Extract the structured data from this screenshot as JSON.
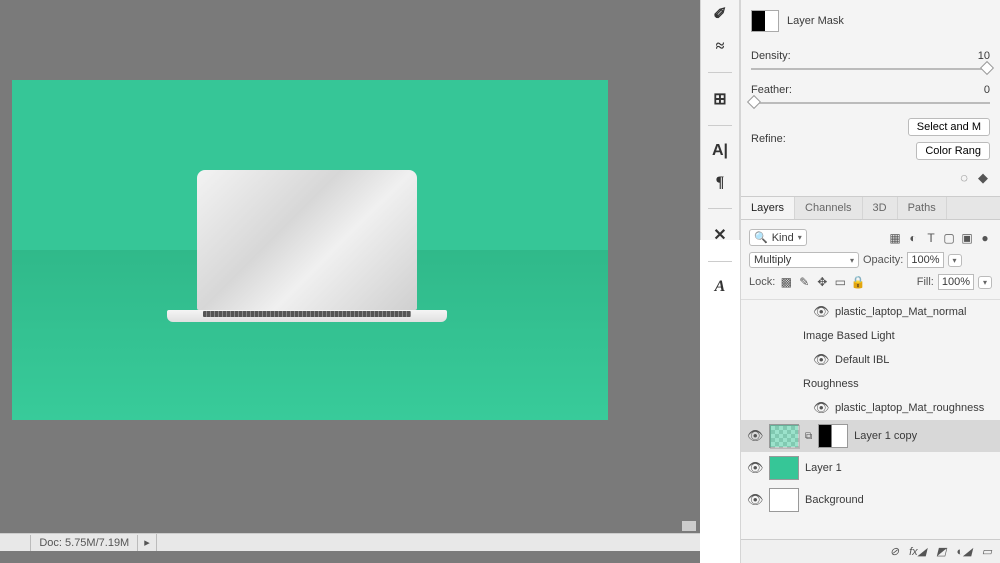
{
  "canvas": {
    "doc_info": "Doc: 5.75M/7.19M"
  },
  "tool_strip": [
    "healing",
    "smudge",
    "crop",
    "A-vert",
    "paragraph",
    "wrench",
    "A-italic"
  ],
  "mask_panel": {
    "title": "Layer Mask",
    "density": {
      "label": "Density:",
      "value": "10"
    },
    "feather": {
      "label": "Feather:",
      "value": "0"
    },
    "refine_label": "Refine:",
    "btn_select_mask": "Select and M",
    "btn_color_range": "Color Rang"
  },
  "tabs": {
    "items": [
      "Layers",
      "Channels",
      "3D",
      "Paths"
    ],
    "active": 0
  },
  "layer_opts": {
    "filter_kind": "Kind",
    "blend_mode": "Multiply",
    "opacity_label": "Opacity:",
    "opacity_value": "100%",
    "lock_label": "Lock:",
    "fill_label": "Fill:",
    "fill_value": "100%"
  },
  "layers": {
    "row1": "plastic_laptop_Mat_normal",
    "group1": "Image Based Light",
    "row2": "Default IBL",
    "group2": "Roughness",
    "row3": "plastic_laptop_Mat_roughness",
    "sel": "Layer 1 copy",
    "l1": "Layer 1",
    "bg": "Background"
  },
  "bottom_icons": [
    "link",
    "fx",
    "mask",
    "adjust",
    "group",
    "new",
    "trash"
  ]
}
